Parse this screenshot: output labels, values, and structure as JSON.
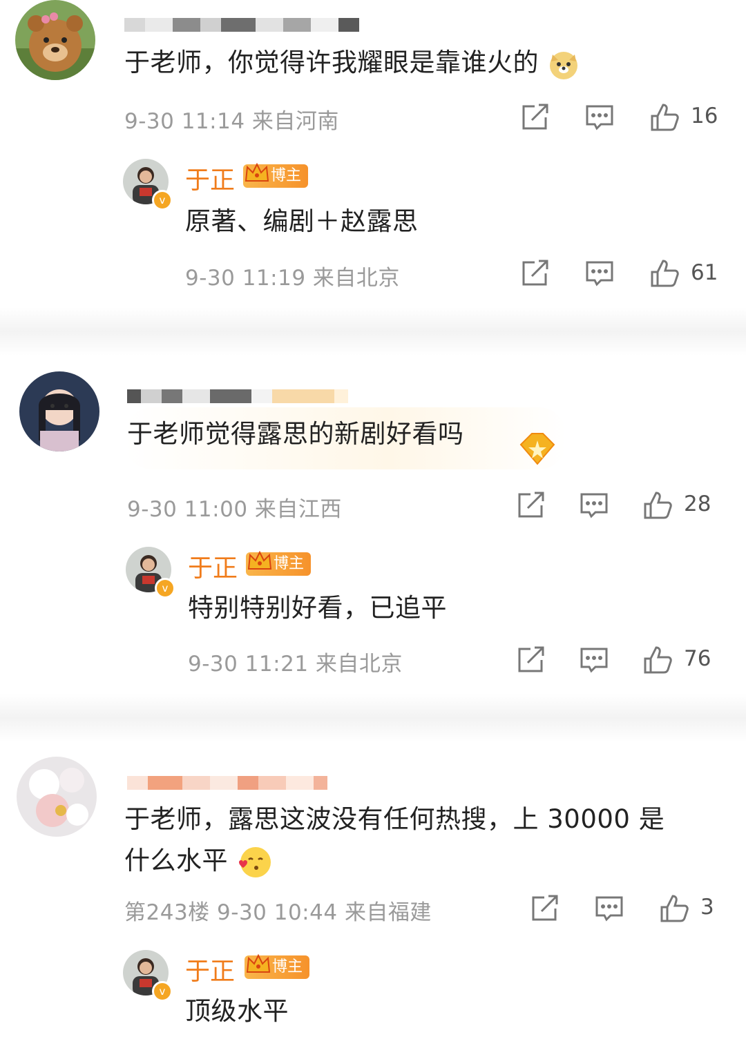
{
  "comments": [
    {
      "text": "于老师，你觉得许我耀眼是靠谁火的",
      "time": "9-30 11:14",
      "location": "来自河南",
      "likes": "16",
      "emoji_icon": "doge-emoji",
      "reply": {
        "author": "于正",
        "badge": "博主",
        "text": "原著、编剧＋赵露思",
        "time": "9-30 11:19",
        "location": "来自北京",
        "likes": "61"
      }
    },
    {
      "text": "于老师觉得露思的新剧好看吗",
      "time": "9-30 11:00",
      "location": "来自江西",
      "likes": "28",
      "emoji_icon": "star-badge",
      "reply": {
        "author": "于正",
        "badge": "博主",
        "text": "特别特别好看，已追平",
        "time": "9-30 11:21",
        "location": "来自北京",
        "likes": "76"
      }
    },
    {
      "text_line1": "于老师，露思这波没有任何热搜，上 30000 是",
      "text_line2": "什么水平",
      "floor": "第243楼",
      "time": "9-30 10:44",
      "location": "来自福建",
      "likes": "3",
      "emoji_icon": "kiss-emoji",
      "reply": {
        "author": "于正",
        "badge": "博主",
        "text": "顶级水平"
      }
    }
  ],
  "colors": {
    "author_name": "#f07c1b",
    "badge": "#f6922b",
    "meta_text": "#9a9a9a"
  }
}
